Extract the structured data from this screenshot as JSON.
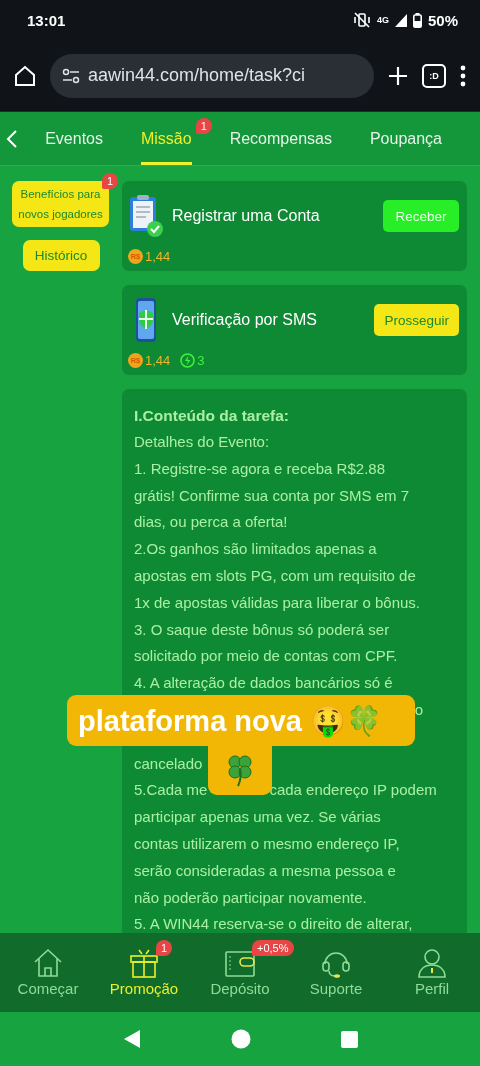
{
  "status_bar": {
    "time": "13:01",
    "network": "4G",
    "battery": "50%"
  },
  "browser": {
    "url": "aawin44.com/home/task?ci",
    "tabs_label": ":D"
  },
  "tabs": [
    {
      "label": "Eventos",
      "selected": false
    },
    {
      "label": "Missão",
      "selected": true,
      "badge": "1"
    },
    {
      "label": "Recompensas",
      "selected": false
    },
    {
      "label": "Poupança",
      "selected": false
    }
  ],
  "sidebar": [
    {
      "label": "Benefícios para novos jogadores",
      "badge": "1",
      "kind": "wide"
    },
    {
      "label": "Histórico",
      "kind": "narrow"
    }
  ],
  "tasks": [
    {
      "title": "Registrar uma Conta",
      "button": {
        "label": "Receber",
        "kind": "claim"
      },
      "rewards": [
        {
          "kind": "coin",
          "symbol": "R$",
          "value": "1,44"
        }
      ]
    },
    {
      "title": "Verificação por SMS",
      "button": {
        "label": "Prosseguir",
        "kind": "go"
      },
      "rewards": [
        {
          "kind": "coin",
          "symbol": "R$",
          "value": "1,44"
        },
        {
          "kind": "energy",
          "value": "3"
        }
      ]
    }
  ],
  "rules": {
    "heading": "I.Conteúdo da tarefa:",
    "lines": [
      {
        "text": "Detalhes do Evento:"
      },
      {
        "text": "1. Registre-se agora e receba R$2.88"
      },
      {
        "text": "grátis! Confirme sua conta por SMS em 7"
      },
      {
        "text": "dias, ou perca a oferta!"
      },
      {
        "text": "2.Os ganhos são limitados apenas a"
      },
      {
        "text": "apostas em slots PG, com um requisito de"
      },
      {
        "text": "1x de apostas válidas para liberar o bônus."
      },
      {
        "text": "3. O saque deste bônus só poderá ser"
      },
      {
        "text": "solicitado por meio de contas com CPF."
      },
      {
        "text": "4. A alteração de dados bancários só é"
      },
      {
        "kind": "tail",
        "text": "o"
      },
      {
        "text": "cancelado"
      },
      {
        "kind": "split",
        "parts": [
          "5.Cada me",
          "cada endereço IP podem"
        ]
      },
      {
        "text": "participar apenas uma vez. Se várias"
      },
      {
        "text": "contas utilizarem o mesmo endereço IP,"
      },
      {
        "text": "serão consideradas a mesma pessoa e"
      },
      {
        "text": "não poderão participar novamente."
      },
      {
        "text": "5. A WIN44 reserva-se o direito de alterar,"
      }
    ]
  },
  "sticker": {
    "text": "plataforma nova 🤑🍀"
  },
  "bottom_nav": [
    {
      "label": "Começar",
      "selected": false
    },
    {
      "label": "Promoção",
      "selected": true,
      "badge": "1"
    },
    {
      "label": "Depósito",
      "selected": false,
      "badge": "+0,5%"
    },
    {
      "label": "Suporte",
      "selected": false
    },
    {
      "label": "Perfil",
      "selected": false
    }
  ]
}
